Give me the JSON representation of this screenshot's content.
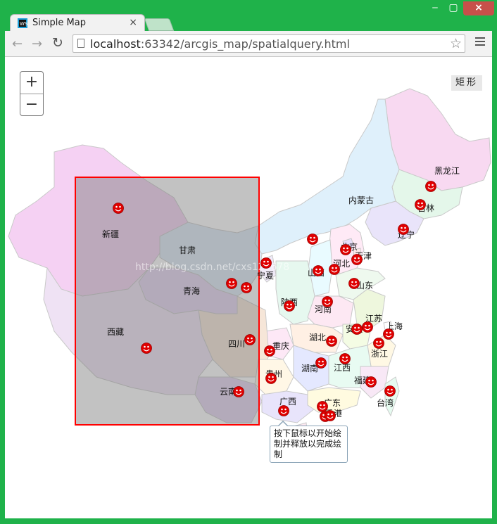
{
  "browser": {
    "tab_title": "Simple Map",
    "tab_close": "×",
    "url_host": "localhost",
    "url_rest": ":63342/arcgis_map/spatialquery.html",
    "win_min": "‒",
    "win_max": "▢",
    "win_close": "×"
  },
  "map": {
    "zoom_in": "+",
    "zoom_out": "−",
    "rectangle_button": "矩形",
    "tooltip": "按下鼠标以开始绘制并释放以完成绘制",
    "provinces": [
      {
        "name": "黑龙江",
        "label": "黑龙江"
      },
      {
        "name": "吉林",
        "label": "吉林"
      },
      {
        "name": "辽宁",
        "label": "辽宁"
      },
      {
        "name": "内蒙古",
        "label": "内蒙古"
      },
      {
        "name": "北京",
        "label": "北京"
      },
      {
        "name": "天津",
        "label": "天津"
      },
      {
        "name": "河北",
        "label": "河北"
      },
      {
        "name": "山西",
        "label": "山西"
      },
      {
        "name": "山东",
        "label": "山东"
      },
      {
        "name": "宁夏",
        "label": "宁夏"
      },
      {
        "name": "陕西",
        "label": "陕西"
      },
      {
        "name": "河南",
        "label": "河南"
      },
      {
        "name": "江苏",
        "label": "江苏"
      },
      {
        "name": "安徽",
        "label": "安徽"
      },
      {
        "name": "上海",
        "label": "上海"
      },
      {
        "name": "湖北",
        "label": "湖北"
      },
      {
        "name": "浙江",
        "label": "浙江"
      },
      {
        "name": "重庆",
        "label": "重庆"
      },
      {
        "name": "四川",
        "label": "四川"
      },
      {
        "name": "湖南",
        "label": "湖南"
      },
      {
        "name": "江西",
        "label": "江西"
      },
      {
        "name": "贵州",
        "label": "贵州"
      },
      {
        "name": "福建",
        "label": "福建"
      },
      {
        "name": "台湾",
        "label": "台湾"
      },
      {
        "name": "云南",
        "label": "云南"
      },
      {
        "name": "广西",
        "label": "广西"
      },
      {
        "name": "广东",
        "label": "广东"
      },
      {
        "name": "香港",
        "label": "香港"
      },
      {
        "name": "新疆",
        "label": "新疆"
      },
      {
        "name": "甘肃",
        "label": "甘肃"
      },
      {
        "name": "青海",
        "label": "青海"
      },
      {
        "name": "西藏",
        "label": "西藏"
      }
    ],
    "marker_icon": "smiley-face-icon",
    "selection_color": "#ff0000",
    "marker_color": "#e00000"
  }
}
